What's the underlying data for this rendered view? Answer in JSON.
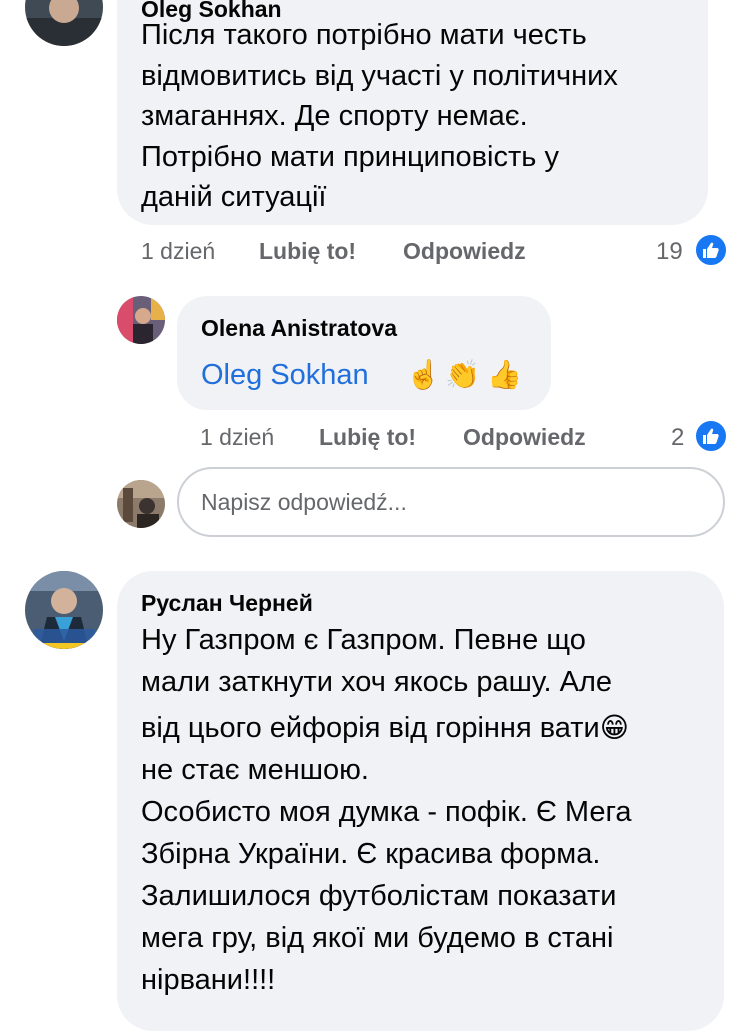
{
  "comment1": {
    "author": "Oleg  Sokhan",
    "lines": [
      "Після такого потрібно мати честь",
      "відмовитись від участі у політичних",
      "змаганнях. Де спорту немає.",
      "Потрібно мати принциповість у",
      "даній ситуації"
    ],
    "time": "1 dzień",
    "like_label": "Lubię to!",
    "reply_label": "Odpowiedz",
    "like_count": "19"
  },
  "comment2": {
    "author": "Olena Anistratova",
    "mention": "Oleg  Sokhan",
    "emojis": [
      "☝️",
      "👏",
      "👍"
    ],
    "time": "1 dzień",
    "like_label": "Lubię to!",
    "reply_label": "Odpowiedz",
    "like_count": "2"
  },
  "reply_box": {
    "placeholder": "Napisz odpowiedź..."
  },
  "comment3": {
    "author": "Руслан Черней",
    "lines": [
      "Ну Газпром є Газпром. Певне що",
      "мали заткнути хоч якось рашу. Але",
      "від цього ейфорія від горіння вати",
      "не стає меншою.",
      "Особисто моя думка - пофік. Є Мега",
      "Збірна України. Є красива форма.",
      "Залишилося футболістам показати",
      "мега гру, від якої ми будемо в стані",
      "нірвани!!!!"
    ],
    "emoji": "😁"
  },
  "colors": {
    "bubble": "#f0f2f5",
    "meta_text": "#65676b",
    "mention": "#216fdb",
    "like_badge": "#1877f2"
  }
}
